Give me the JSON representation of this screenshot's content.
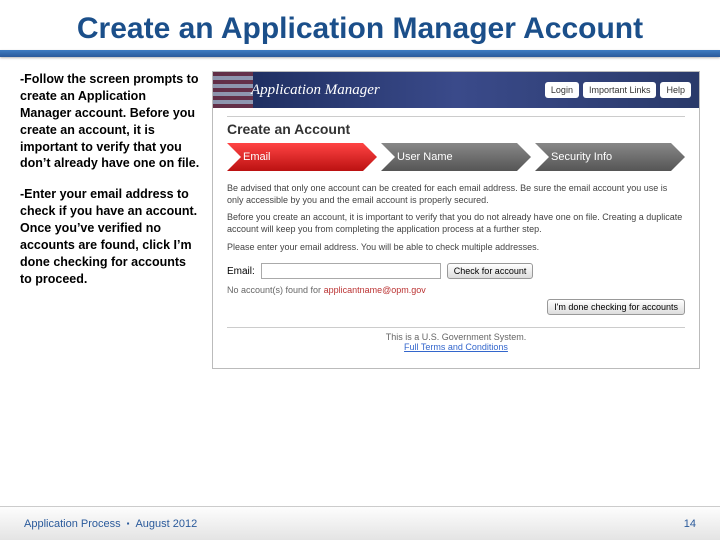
{
  "title": "Create an Application Manager Account",
  "left": {
    "p1": "-Follow the screen prompts to create an Application Manager account.  Before you create an account, it is important to verify that you don’t already have one on file.",
    "p2": "-Enter your email address to check if you have an account. Once you’ve verified no accounts are found, click I’m done checking for accounts to proceed."
  },
  "app": {
    "logo": "Application Manager",
    "buttons": {
      "login": "Login",
      "links": "Important Links",
      "help": "Help"
    },
    "panel_title": "Create an Account",
    "steps": {
      "s1": "Email",
      "s2": "User Name",
      "s3": "Security Info"
    },
    "para1": "Be advised that only one account can be created for each email address. Be sure the email account you use is only accessible by you and the email account is properly secured.",
    "para2": "Before you create an account, it is important to verify that you do not already have one on file. Creating a duplicate account will keep you from completing the application process at a further step.",
    "para3": "Please enter your email address. You will be able to check multiple addresses.",
    "email_label": "Email:",
    "email_value": "",
    "check_btn": "Check for account",
    "status_prefix": "No account(s) found for",
    "status_email": "applicantname@opm.gov",
    "done_btn": "I'm done checking for accounts",
    "gov_line": "This is a U.S. Government System.",
    "gov_link": "Full Terms and Conditions"
  },
  "footer": {
    "left1": "Application Process",
    "left2": "August 2012",
    "page": "14"
  }
}
